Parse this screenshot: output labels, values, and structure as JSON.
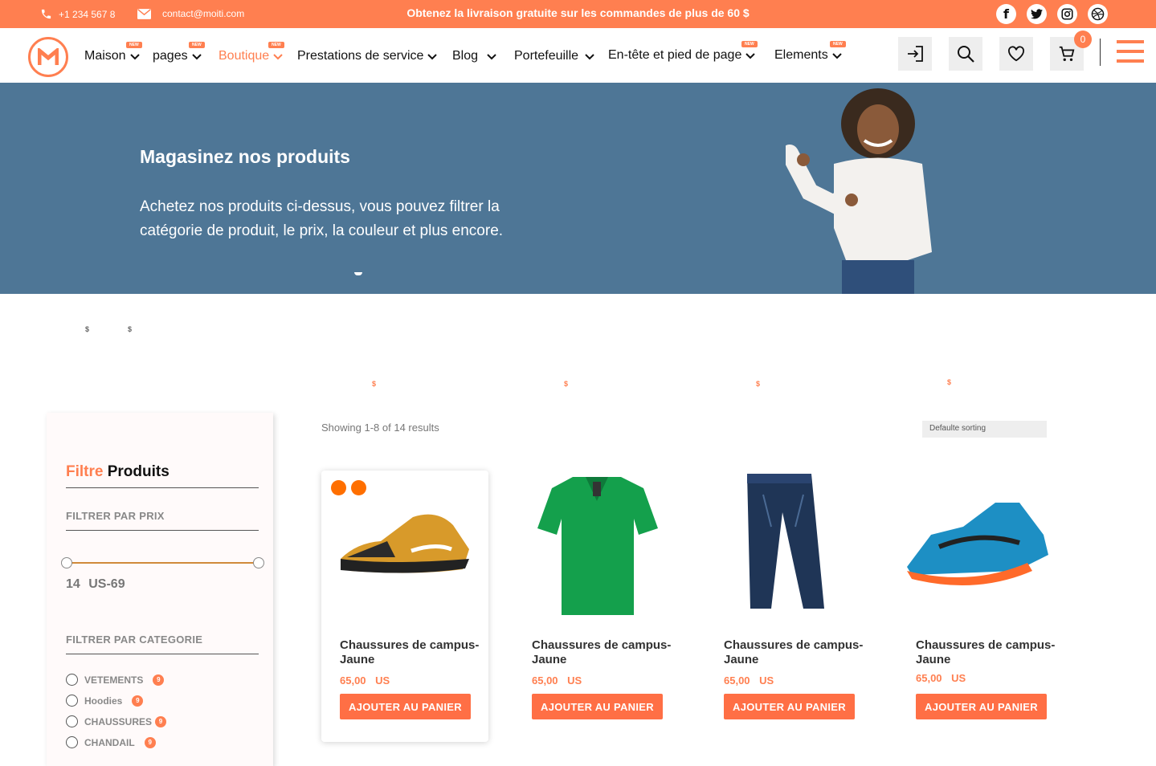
{
  "topbar": {
    "phone": "+1 234 567 8",
    "email": "contact@moiti.com",
    "promo": "Obtenez la livraison gratuite sur les commandes de plus de 60 $",
    "socials": [
      "facebook-icon",
      "twitter-icon",
      "instagram-icon",
      "dribbble-icon"
    ]
  },
  "nav": {
    "items": [
      {
        "label": "Maison",
        "new": "NEW"
      },
      {
        "label": "pages",
        "new": "NEW"
      },
      {
        "label": "Boutique",
        "new": "NEW"
      },
      {
        "label": "Prestations de service"
      },
      {
        "label": "Blog"
      },
      {
        "label": "Portefeuille"
      },
      {
        "label": "En-tête et pied de page",
        "new": "NEW"
      },
      {
        "label": "Elements",
        "new": "NEW"
      }
    ],
    "cart_count": "0"
  },
  "hero": {
    "title": "Magasinez nos produits",
    "text": "Achetez nos produits ci-dessus, vous pouvez filtrer la catégorie de produit, le prix, la couleur et plus encore."
  },
  "stray": {
    "dollar": "$"
  },
  "sidebar": {
    "title_accent": "Filtre",
    "title_rest": " Produits",
    "price_heading": "FILTRER PAR PRIX",
    "price_range": "14 US-69",
    "category_heading": "FILTRER PAR CATEGORIE",
    "categories": [
      {
        "label": "VETEMENTS",
        "count": "9"
      },
      {
        "label": "Hoodies",
        "count": "9"
      },
      {
        "label": "CHAUSSURES",
        "count": "9"
      },
      {
        "label": "CHANDAIL",
        "count": "9"
      }
    ]
  },
  "listing": {
    "showing": "Showing 1-8 of 14 results",
    "sort": "Defaulte sorting",
    "products": [
      {
        "name": "Chaussures de campus-Jaune",
        "price": "65,00 US",
        "button": "AJOUTER AU PANIER"
      },
      {
        "name": "Chaussures de campus-Jaune",
        "price": "65,00 US",
        "button": "AJOUTER AU PANIER"
      },
      {
        "name": "Chaussures de campus-Jaune",
        "price": "65,00 US",
        "button": "AJOUTER AU PANIER"
      },
      {
        "name": "Chaussures de campus-Jaune",
        "price": "65,00 US",
        "button": "AJOUTER AU PANIER"
      }
    ]
  },
  "colors": {
    "accent": "#ff7f50",
    "hero_bg": "#4e7696"
  }
}
